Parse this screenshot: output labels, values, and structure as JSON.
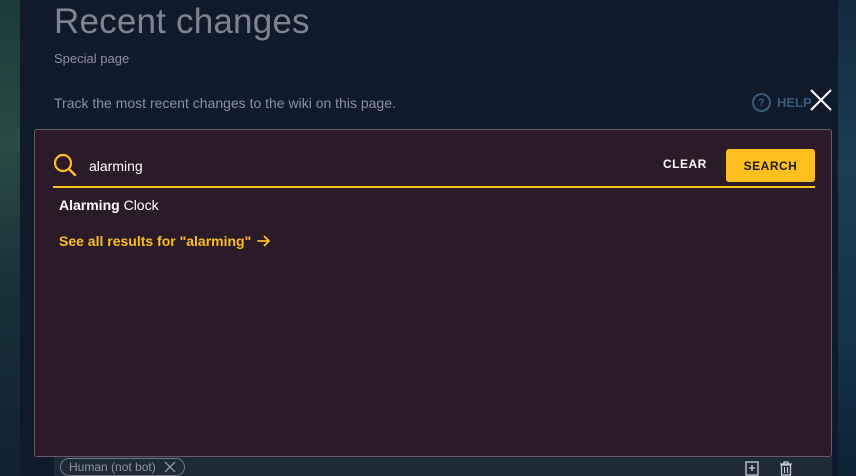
{
  "page": {
    "title": "Recent changes",
    "subtitle": "Special page",
    "description": "Track the most recent changes to the wiki on this page.",
    "help_label": "HELP",
    "help_icon": "question-circle-icon"
  },
  "search": {
    "value": "alarming",
    "clear_label": "CLEAR",
    "submit_label": "SEARCH",
    "results": [
      {
        "bold": "Alarming",
        "rest": " Clock"
      }
    ],
    "see_all_label": "See all results for \"alarming\""
  },
  "filters": {
    "chip_label": "Human (not bot)"
  },
  "colors": {
    "accent": "#fcbf1e",
    "modal_bg": "#2b1b28",
    "page_bg": "#0f1a2b"
  }
}
